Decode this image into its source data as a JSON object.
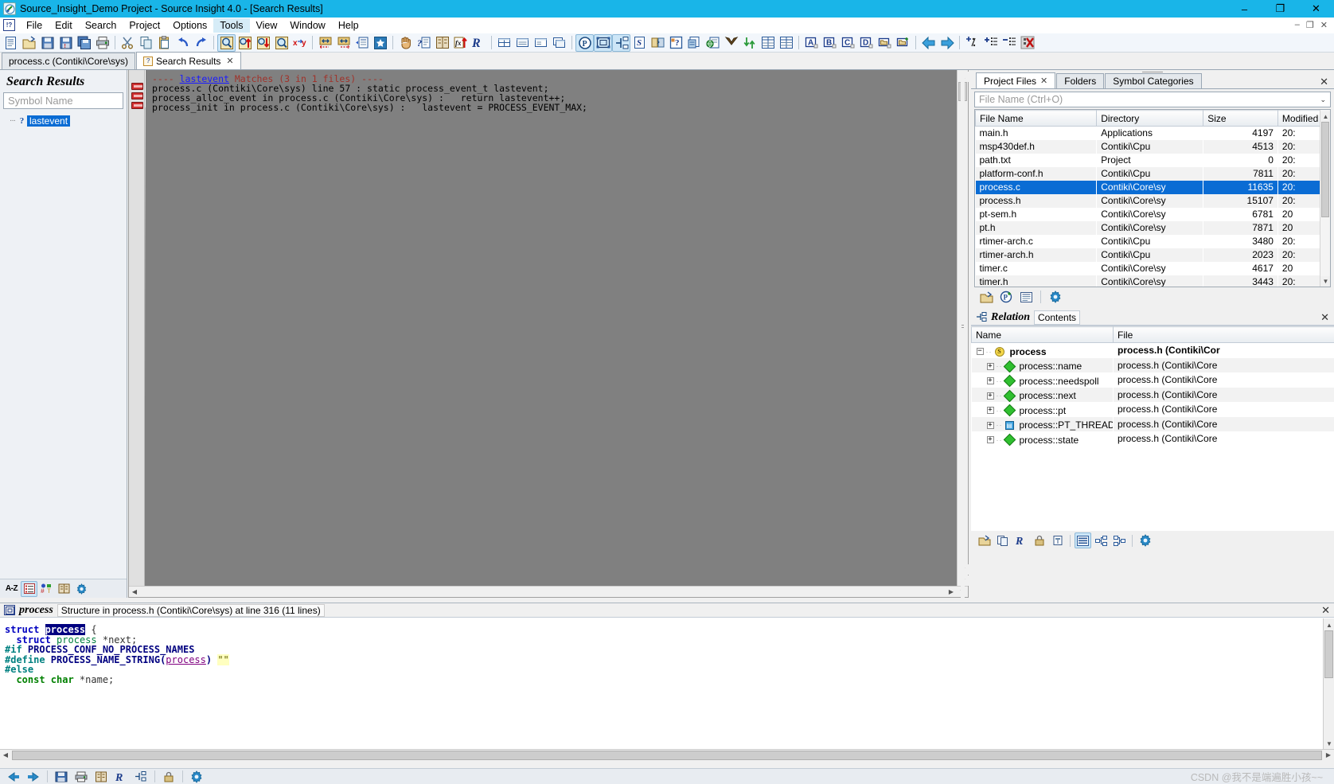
{
  "window": {
    "title": "Source_Insight_Demo Project - Source Insight 4.0 - [Search Results]",
    "app_icon": "source-insight-icon",
    "minimize": "–",
    "maximize": "❐",
    "close": "✕"
  },
  "menubar": {
    "items": [
      "File",
      "Edit",
      "Search",
      "Project",
      "Options",
      "Tools",
      "View",
      "Window",
      "Help"
    ],
    "active_item": "Tools",
    "mdi_minimize": "–",
    "mdi_restore": "❐",
    "mdi_close": "✕"
  },
  "tabs": [
    {
      "label": "process.c (Contiki\\Core\\sys)",
      "active": false,
      "closable": false
    },
    {
      "label": "Search Results",
      "active": true,
      "closable": true,
      "close_glyph": "✕"
    }
  ],
  "search_panel": {
    "title": "Search Results",
    "input_placeholder": "Symbol Name",
    "input_value": "",
    "items": [
      {
        "label": "lastevent",
        "selected": true,
        "icon": "symbol-question-icon"
      }
    ],
    "toolbar": [
      {
        "name": "sort-alpha-button",
        "label": "A-Z"
      },
      {
        "name": "list-view-button",
        "label": "list"
      },
      {
        "name": "symbol-type-button",
        "label": "symbols"
      },
      {
        "name": "book-button",
        "label": "book"
      },
      {
        "name": "settings-button",
        "label": "gear"
      }
    ]
  },
  "results_doc": {
    "lines": [
      {
        "marker": false,
        "parts": [
          {
            "t": "---- ",
            "c": "hl"
          },
          {
            "t": "lastevent",
            "c": "lnk"
          },
          {
            "t": " Matches (3 in 1 files) ----",
            "c": "hl"
          }
        ]
      },
      {
        "marker": true,
        "parts": [
          {
            "t": "process.c (Contiki\\Core\\sys) line 57 : static process_event_t lastevent;",
            "c": ""
          }
        ]
      },
      {
        "marker": true,
        "parts": [
          {
            "t": "process_alloc_event in process.c (Contiki\\Core\\sys) :   return lastevent++;",
            "c": ""
          }
        ]
      },
      {
        "marker": true,
        "parts": [
          {
            "t": "process_init in process.c (Contiki\\Core\\sys) :   lastevent = PROCESS_EVENT_MAX;",
            "c": ""
          }
        ]
      }
    ]
  },
  "project_panel": {
    "tabs": [
      {
        "label": "Project Files",
        "active": true,
        "closable": true,
        "close_glyph": "✕"
      },
      {
        "label": "Folders",
        "active": false,
        "closable": false
      },
      {
        "label": "Symbol Categories",
        "active": false,
        "closable": false
      }
    ],
    "panel_close": "✕",
    "filter_placeholder": "File Name (Ctrl+O)",
    "filter_value": "",
    "filter_caret": "⌄",
    "columns": [
      "File Name",
      "Directory",
      "Size",
      "Modified"
    ],
    "rows": [
      {
        "file": "main.h",
        "dir": "Applications",
        "size": "4197",
        "modified": "20:",
        "selected": false
      },
      {
        "file": "msp430def.h",
        "dir": "Contiki\\Cpu",
        "size": "4513",
        "modified": "20:",
        "selected": false
      },
      {
        "file": "path.txt",
        "dir": "Project",
        "size": "0",
        "modified": "20:",
        "selected": false
      },
      {
        "file": "platform-conf.h",
        "dir": "Contiki\\Cpu",
        "size": "7811",
        "modified": "20:",
        "selected": false
      },
      {
        "file": "process.c",
        "dir": "Contiki\\Core\\sy",
        "size": "11635",
        "modified": "20:",
        "selected": true
      },
      {
        "file": "process.h",
        "dir": "Contiki\\Core\\sy",
        "size": "15107",
        "modified": "20:",
        "selected": false
      },
      {
        "file": "pt-sem.h",
        "dir": "Contiki\\Core\\sy",
        "size": "6781",
        "modified": "20",
        "selected": false
      },
      {
        "file": "pt.h",
        "dir": "Contiki\\Core\\sy",
        "size": "7871",
        "modified": "20",
        "selected": false
      },
      {
        "file": "rtimer-arch.c",
        "dir": "Contiki\\Cpu",
        "size": "3480",
        "modified": "20:",
        "selected": false
      },
      {
        "file": "rtimer-arch.h",
        "dir": "Contiki\\Cpu",
        "size": "2023",
        "modified": "20:",
        "selected": false
      },
      {
        "file": "timer.c",
        "dir": "Contiki\\Core\\sy",
        "size": "4617",
        "modified": "20",
        "selected": false
      },
      {
        "file": "timer.h",
        "dir": "Contiki\\Core\\sy",
        "size": "3443",
        "modified": "20:",
        "selected": false
      }
    ],
    "toolbar": [
      {
        "name": "open-file-button",
        "label": "open"
      },
      {
        "name": "add-project-file-button",
        "label": "add"
      },
      {
        "name": "file-properties-button",
        "label": "props"
      },
      {
        "name": "project-settings-button",
        "label": "gear"
      }
    ]
  },
  "relation_panel": {
    "title": "Relation",
    "subtitle": "Contents",
    "panel_close": "✕",
    "columns": [
      "Name",
      "File"
    ],
    "rows": [
      {
        "name": "process",
        "file": "process.h (Contiki\\Cor",
        "indent": 0,
        "icon": "struct-icon",
        "bold": true,
        "expander": "−"
      },
      {
        "name": "process::name",
        "file": "process.h (Contiki\\Core",
        "indent": 1,
        "icon": "member-icon",
        "bold": false,
        "expander": "+"
      },
      {
        "name": "process::needspoll",
        "file": "process.h (Contiki\\Core",
        "indent": 1,
        "icon": "member-icon",
        "bold": false,
        "expander": "+"
      },
      {
        "name": "process::next",
        "file": "process.h (Contiki\\Core",
        "indent": 1,
        "icon": "member-icon",
        "bold": false,
        "expander": "+"
      },
      {
        "name": "process::pt",
        "file": "process.h (Contiki\\Core",
        "indent": 1,
        "icon": "member-icon",
        "bold": false,
        "expander": "+"
      },
      {
        "name": "process::PT_THREAD",
        "file": "process.h (Contiki\\Core",
        "indent": 1,
        "icon": "macro-icon",
        "bold": false,
        "expander": "+"
      },
      {
        "name": "process::state",
        "file": "process.h (Contiki\\Core",
        "indent": 1,
        "icon": "member-icon",
        "bold": false,
        "expander": "+"
      }
    ],
    "toolbar": [
      {
        "name": "relation-window-button",
        "label": "rel"
      },
      {
        "name": "copy-relation-button",
        "label": "copy"
      },
      {
        "name": "reference-button",
        "label": "R"
      },
      {
        "name": "lock-button",
        "label": "lock"
      },
      {
        "name": "pin-button",
        "label": "pin"
      },
      {
        "name": "list-layout-button",
        "label": "list"
      },
      {
        "name": "tree-layout-button",
        "label": "tree"
      },
      {
        "name": "graph-layout-button",
        "label": "graph"
      },
      {
        "name": "relation-settings-button",
        "label": "gear"
      }
    ]
  },
  "context_panel": {
    "symbol": "process",
    "description": "Structure in process.h (Contiki\\Core\\sys) at line 316 (11 lines)",
    "close_glyph": "✕",
    "code_lines": [
      [
        {
          "t": "struct ",
          "c": "kw"
        },
        {
          "t": "process",
          "c": "selname"
        },
        {
          "t": " {",
          "c": "gry"
        }
      ],
      [
        {
          "t": "  ",
          "c": ""
        },
        {
          "t": "struct",
          "c": "kw"
        },
        {
          "t": " ",
          "c": ""
        },
        {
          "t": "process",
          "c": "typ"
        },
        {
          "t": " *next;",
          "c": "gry"
        }
      ],
      [
        {
          "t": "#if",
          "c": "pp"
        },
        {
          "t": " PROCESS_CONF_NO_PROCESS_NAMES",
          "c": "mac"
        }
      ],
      [
        {
          "t": "#define",
          "c": "pp"
        },
        {
          "t": " PROCESS_NAME_STRING(",
          "c": "mac"
        },
        {
          "t": "process",
          "c": "lnkc"
        },
        {
          "t": ") ",
          "c": "mac"
        },
        {
          "t": "\"\"",
          "c": "strlit"
        }
      ],
      [
        {
          "t": "#else",
          "c": "pp"
        }
      ],
      [
        {
          "t": "  ",
          "c": ""
        },
        {
          "t": "const char",
          "c": "kwp"
        },
        {
          "t": " *name;",
          "c": "gry"
        }
      ]
    ]
  },
  "statusbar": {
    "buttons": [
      {
        "name": "nav-back-button",
        "label": "back"
      },
      {
        "name": "nav-forward-button",
        "label": "forward"
      },
      {
        "name": "save-button",
        "label": "save"
      },
      {
        "name": "print-button",
        "label": "print"
      },
      {
        "name": "book-button",
        "label": "book"
      },
      {
        "name": "reference-button",
        "label": "R"
      },
      {
        "name": "relation-button",
        "label": "relation"
      },
      {
        "name": "lock-button",
        "label": "lock"
      },
      {
        "name": "settings-button",
        "label": "gear"
      }
    ],
    "watermark": "CSDN @我不是端遍胜小孩~~"
  },
  "toolbar": {
    "groups": [
      {
        "buttons": [
          {
            "name": "new-file-button",
            "icon": "new-document-icon",
            "active": false
          },
          {
            "name": "open-file-button",
            "icon": "open-folder-icon",
            "active": false
          },
          {
            "name": "save-button",
            "icon": "floppy-save-icon",
            "active": false
          },
          {
            "name": "save-as-button",
            "icon": "floppy-saveas-icon",
            "active": false
          },
          {
            "name": "save-all-button",
            "icon": "floppy-saveall-icon",
            "active": false
          },
          {
            "name": "print-button",
            "icon": "printer-icon",
            "active": false
          }
        ]
      },
      {
        "buttons": [
          {
            "name": "cut-button",
            "icon": "scissors-icon",
            "active": false
          },
          {
            "name": "copy-button",
            "icon": "copy-icon",
            "active": false
          },
          {
            "name": "paste-button",
            "icon": "clipboard-paste-icon",
            "active": false
          },
          {
            "name": "undo-button",
            "icon": "undo-arrow-icon",
            "active": false
          },
          {
            "name": "redo-button",
            "icon": "redo-arrow-icon",
            "active": false
          }
        ]
      },
      {
        "buttons": [
          {
            "name": "search-button",
            "icon": "magnifier-icon",
            "active": true
          },
          {
            "name": "search-backward-button",
            "icon": "magnifier-up-icon",
            "active": false
          },
          {
            "name": "search-forward-button",
            "icon": "magnifier-down-icon",
            "active": false
          },
          {
            "name": "search-files-button",
            "icon": "magnifier-files-icon",
            "active": false
          },
          {
            "name": "replace-button",
            "icon": "xy-replace-icon",
            "active": false
          }
        ]
      },
      {
        "buttons": [
          {
            "name": "jump-back-button",
            "icon": "jump-left-icon",
            "active": false
          },
          {
            "name": "jump-forward-button",
            "icon": "jump-right-icon",
            "active": false
          },
          {
            "name": "bookmark-list-button",
            "icon": "bookmark-list-icon",
            "active": false
          },
          {
            "name": "bookmark-button",
            "icon": "star-icon",
            "active": false
          }
        ]
      },
      {
        "buttons": [
          {
            "name": "browse-symbols-button",
            "icon": "hand-icon",
            "active": false
          },
          {
            "name": "symbol-info-button",
            "icon": "question-page-icon",
            "active": false
          },
          {
            "name": "book-button",
            "icon": "book-icon",
            "active": false
          },
          {
            "name": "function-jump-button",
            "icon": "fx-up-icon",
            "active": false
          },
          {
            "name": "reference-button",
            "icon": "r-script-icon",
            "active": false
          }
        ]
      },
      {
        "buttons": [
          {
            "name": "tile-windows-button",
            "icon": "tile-grid-icon",
            "active": false
          },
          {
            "name": "tile-horizontal-button",
            "icon": "tile-horizontal-icon",
            "active": false
          },
          {
            "name": "tile-vertical-button",
            "icon": "tile-vertical-icon",
            "active": false
          },
          {
            "name": "cascade-windows-button",
            "icon": "cascade-icon",
            "active": false
          }
        ]
      },
      {
        "buttons": [
          {
            "name": "project-button",
            "icon": "circle-p-icon",
            "active": true
          },
          {
            "name": "context-window-button",
            "icon": "context-frame-icon",
            "active": true
          },
          {
            "name": "relation-window-button",
            "icon": "relation-icon",
            "active": true
          },
          {
            "name": "symbol-window-button",
            "icon": "s-page-icon",
            "active": false
          },
          {
            "name": "file-compare-button",
            "icon": "compare-icon",
            "active": false
          },
          {
            "name": "help-button",
            "icon": "help-page-icon",
            "active": false
          },
          {
            "name": "clip-window-button",
            "icon": "clip-icon",
            "active": false
          },
          {
            "name": "web-button",
            "icon": "globe-page-icon",
            "active": false
          },
          {
            "name": "checkin-button",
            "icon": "down-arrow-icon",
            "active": false
          },
          {
            "name": "sync-button",
            "icon": "sync-arrows-icon",
            "active": false
          },
          {
            "name": "table-button",
            "icon": "table-icon",
            "active": false
          },
          {
            "name": "table2-button",
            "icon": "table-two-icon",
            "active": false
          }
        ]
      },
      {
        "buttons": [
          {
            "name": "bookmark-a-button",
            "icon": "letter-a-icon",
            "active": false
          },
          {
            "name": "bookmark-b-button",
            "icon": "letter-b-icon",
            "active": false
          },
          {
            "name": "bookmark-c-button",
            "icon": "letter-c-icon",
            "active": false
          },
          {
            "name": "bookmark-d-button",
            "icon": "letter-d-icon",
            "active": false
          },
          {
            "name": "folder-button",
            "icon": "folder-icon",
            "active": false
          },
          {
            "name": "new-folder-button",
            "icon": "new-folder-icon",
            "active": false
          }
        ]
      },
      {
        "buttons": [
          {
            "name": "back-button",
            "icon": "big-left-arrow-icon",
            "active": false
          },
          {
            "name": "forward-button",
            "icon": "big-right-arrow-icon",
            "active": false
          }
        ]
      },
      {
        "buttons": [
          {
            "name": "add-fraction-button",
            "icon": "plus-slash-icon",
            "active": false
          },
          {
            "name": "add-list-button",
            "icon": "plus-list-icon",
            "active": false
          },
          {
            "name": "remove-list-button",
            "icon": "minus-list-icon",
            "active": false
          },
          {
            "name": "delete-list-button",
            "icon": "delete-x-icon",
            "active": false
          }
        ]
      }
    ]
  },
  "colors": {
    "titlebar": "#19b5e8",
    "selection": "#0a6cd4",
    "toolbar_active": "#cde6f7",
    "doc_background": "#808080"
  }
}
